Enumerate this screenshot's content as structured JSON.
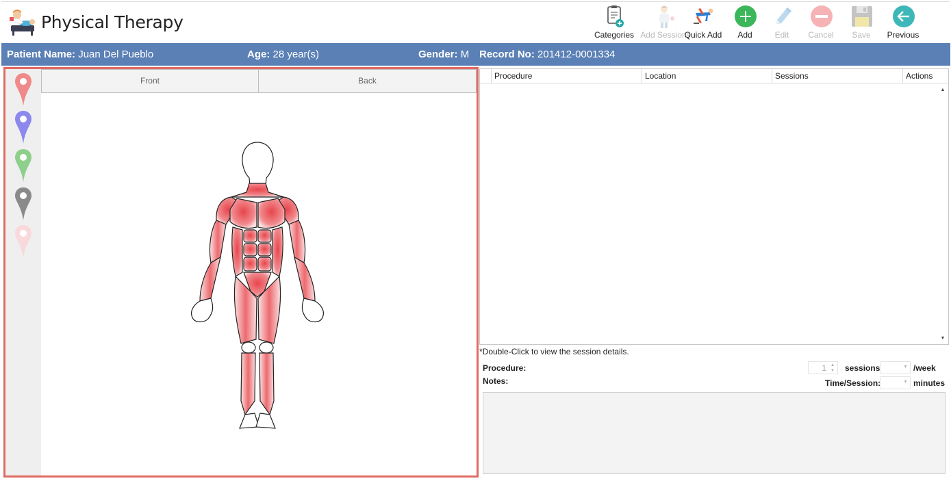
{
  "app": {
    "title": "Physical Therapy"
  },
  "toolbar": {
    "categories": "Categories",
    "add_sessions": "Add Sessions",
    "quick_add": "Quick Add",
    "add": "Add",
    "edit": "Edit",
    "cancel": "Cancel",
    "save": "Save",
    "previous": "Previous"
  },
  "patient": {
    "name_label": "Patient Name:",
    "name": "Juan Del Pueblo",
    "age_label": "Age:",
    "age": "28 year(s)",
    "gender_label": "Gender:",
    "gender": "M",
    "record_label": "Record No:",
    "record": "201412-0001334"
  },
  "body_view": {
    "tabs": [
      "Front",
      "Back"
    ],
    "selected_tab": "Front",
    "pin_colors": [
      "#f08a8a",
      "#8c88ee",
      "#8fcf8c",
      "#8a8a8a",
      "#f9d9dc"
    ]
  },
  "grid": {
    "columns": [
      "Procedure",
      "Location",
      "Sessions",
      "Actions"
    ],
    "rows": []
  },
  "details": {
    "hint": "*Double-Click to view the session details.",
    "procedure_label": "Procedure:",
    "notes_label": "Notes:",
    "sessions_value": "1",
    "sessions_label": "sessions,",
    "week_label": "/week",
    "time_session_label": "Time/Session:",
    "minutes_label": "minutes"
  },
  "colors": {
    "patient_bar": "#5a80b6",
    "panel_border": "#e06a62",
    "muscle": "#e8454b",
    "add_green": "#3cb65a",
    "previous_teal": "#3fb7b8"
  }
}
